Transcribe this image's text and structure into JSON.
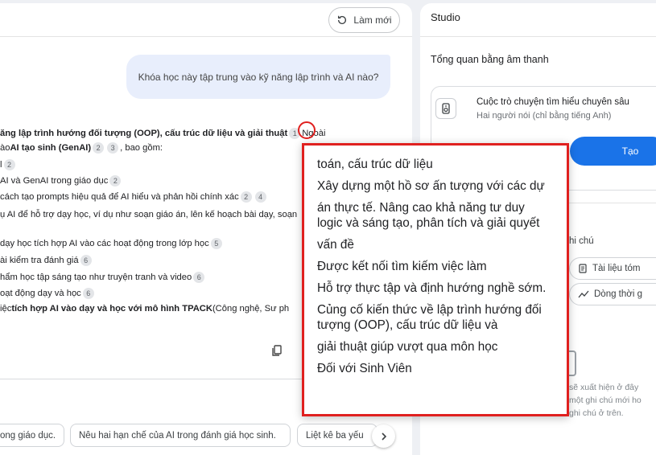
{
  "chat": {
    "refresh_label": "Làm mới",
    "user_question": "Khóa học này tập trung vào kỹ năng lập trình và AI nào?",
    "answer_lines": [
      {
        "pre": "",
        "bold": "ăng lập trình hướng đối tượng (OOP), cấu trúc dữ liệu và giải thuật",
        "cites": [
          "1"
        ],
        "post": "Ngoài"
      },
      {
        "pre": "ào ",
        "bold": "AI tạo sinh (GenAI)",
        "cites": [
          "2",
          "3"
        ],
        "post": ", bao gồm:"
      },
      {
        "pre": "l",
        "bold": "",
        "cites": [
          "2"
        ],
        "post": ""
      },
      {
        "pre": "AI và GenAI trong giáo dục",
        "bold": "",
        "cites": [
          "2"
        ],
        "post": ""
      },
      {
        "pre": "cách tạo prompts hiệu quả để AI hiểu và phản hồi chính xác",
        "bold": "",
        "cites": [
          "2",
          "4"
        ],
        "post": ""
      },
      {
        "pre": "ụ AI để hỗ trợ dạy học, ví dụ như soạn giáo án, lên kế hoạch bài dạy, soạn",
        "bold": "",
        "cites": [],
        "post": ""
      },
      {
        "pre": "dạy học tích hợp AI vào các hoạt động trong lớp học",
        "bold": "",
        "cites": [
          "5"
        ],
        "post": ""
      },
      {
        "pre": "ài kiểm tra đánh giá",
        "bold": "",
        "cites": [
          "6"
        ],
        "post": ""
      },
      {
        "pre": "hẩm học tập sáng tạo như truyện tranh và video",
        "bold": "",
        "cites": [
          "6"
        ],
        "post": ""
      },
      {
        "pre": "oạt động dạy và học",
        "bold": "",
        "cites": [
          "6"
        ],
        "post": ""
      },
      {
        "pre": "iệc ",
        "bold": "tích hợp AI vào dạy và học với mô hình TPACK",
        "cites": [],
        "post": " (Công nghệ, Sư ph"
      }
    ],
    "suggestions": [
      "ong giáo dục.",
      "Nêu hai hạn chế của AI trong đánh giá học sinh.",
      "Liệt kê ba yếu"
    ]
  },
  "studio": {
    "title": "Studio",
    "audio_overview": "Tổng quan bằng âm thanh",
    "audio_card_title": "Cuộc trò chuyện tìm hiểu chuyên sâu",
    "audio_card_sub": "Hai người nói (chỉ bằng tiếng Anh)",
    "generate_label": "Tạo",
    "add_note": "hi chú",
    "study_guide": "Tài liệu tóm",
    "timeline": "Dòng thời g",
    "empty_line1": "sẽ xuất hiện ở đây",
    "empty_line2": "một ghi chú mới ho",
    "empty_line3": "ghi chú ở trên."
  },
  "popup": {
    "items": [
      "toán, cấu trúc dữ liệu",
      "Xây dựng một hồ sơ ấn tượng với các dự",
      "án thực tế. Nâng cao khả năng tư duy logic và sáng tạo, phân tích và giải quyết",
      "vấn đề",
      "Được kết nối tìm kiếm việc làm",
      "Hỗ trợ thực tập và định hướng nghề sớm.",
      "Củng cố kiến thức về lập trình hướng đối tượng (OOP), cấu trúc dữ liệu và",
      "giải thuật giúp vượt qua môn học",
      "Đối với Sinh Viên"
    ]
  },
  "colors": {
    "accent": "#1a73e8",
    "highlight": "#e0201f"
  }
}
